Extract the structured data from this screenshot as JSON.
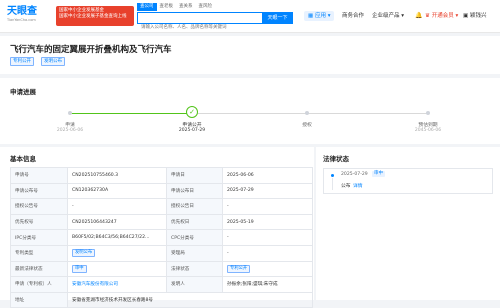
{
  "header": {
    "logo_text": "天眼查",
    "logo_sub": "TianYanCha.com",
    "ad_line1": "国家中小企业发展基金",
    "ad_line2": "国家中小企业发展子基金查询上线",
    "search_tabs": [
      "查公司",
      "查老板",
      "查关系",
      "查风险"
    ],
    "search_placeholder": "请输入公司名称、人名、品牌名称等关键词",
    "search_button": "天眼一下",
    "nav_app": "应用",
    "nav_biz": "商务合作",
    "nav_ent": "企业级产品",
    "nav_vip": "开通会员",
    "nav_user": "颖钱兴",
    "bell_icon": "bell-icon"
  },
  "title": {
    "text": "飞行汽车的固定翼展开折叠机构及飞行汽车",
    "tags": [
      "专利公开",
      "发明公布"
    ]
  },
  "progress": {
    "section_title": "申请进展",
    "steps": [
      {
        "label": "申请",
        "date": "2025-06-06",
        "done": true
      },
      {
        "label": "申请公开",
        "date": "2025-07-29",
        "done": true
      },
      {
        "label": "授权",
        "date": "",
        "done": false
      },
      {
        "label": "预估到期",
        "date": "2045-06-06",
        "done": false
      }
    ]
  },
  "basic_info": {
    "section_title": "基本信息",
    "rows": [
      [
        "申请号",
        "CN202510755460.3",
        "申请日",
        "2025-06-06"
      ],
      [
        "申请公布号",
        "CN120362730A",
        "申请公布日",
        "2025-07-29"
      ],
      [
        "授权公告号",
        "-",
        "授权公告日",
        "-"
      ],
      [
        "优先权号",
        "CN2025106443247",
        "优先权日",
        "2025-05-19"
      ],
      [
        "IPC分类号",
        "B60F5/02;B64C3/56;B64C27/22...",
        "CPC分类号",
        "-"
      ],
      [
        "专利类型",
        "发明公布",
        "受理局",
        "-"
      ],
      [
        "最新法律状态",
        "审中",
        "法律状态",
        "专利公开"
      ],
      [
        "申请（专利权）人",
        "安徽汽车股份有限公司",
        "发明人",
        "孙振余;张阳;盛琪;朱守成"
      ],
      [
        "地址",
        "安徽省芜湖市经济技术开发区长春路8号",
        "",
        ""
      ]
    ]
  },
  "legal_status": {
    "section_title": "法律状态",
    "date": "2025-07-29",
    "badge": "审中",
    "text": "公布",
    "link": "详情"
  },
  "colors": {
    "accent": "#0084ff",
    "done": "#52c41a",
    "vip": "#e8412c"
  }
}
